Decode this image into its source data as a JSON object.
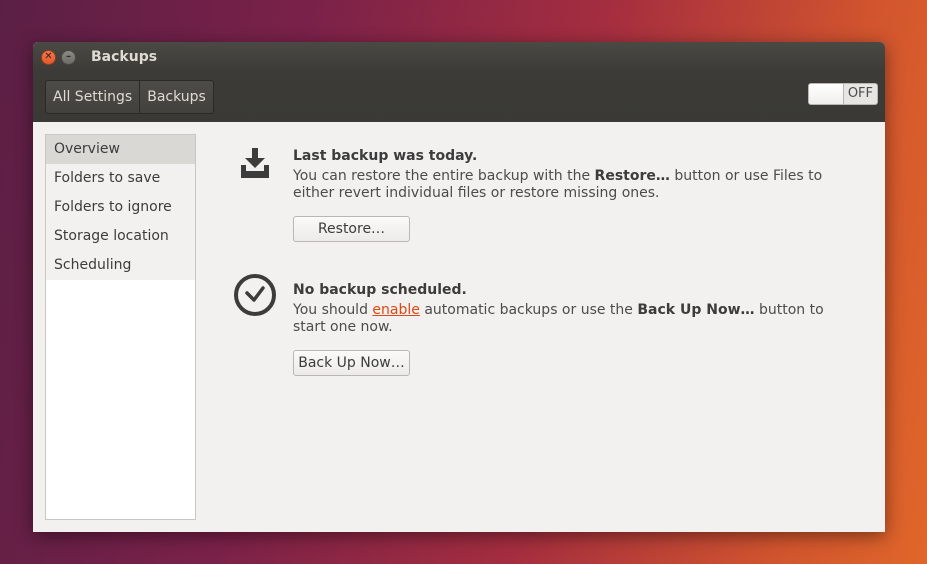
{
  "window": {
    "title": "Backups",
    "close_glyph": "✕",
    "minimize_glyph": "–"
  },
  "toolbar": {
    "nav": [
      "All Settings",
      "Backups"
    ],
    "toggle_label": "OFF"
  },
  "sidebar": {
    "items": [
      {
        "label": "Overview",
        "selected": true
      },
      {
        "label": "Folders to save",
        "selected": false
      },
      {
        "label": "Folders to ignore",
        "selected": false
      },
      {
        "label": "Storage location",
        "selected": false
      },
      {
        "label": "Scheduling",
        "selected": false
      }
    ]
  },
  "last_backup": {
    "icon": "download-tray-icon",
    "heading": "Last backup was today.",
    "desc_1": "You can restore the entire backup with the ",
    "desc_bold": "Restore…",
    "desc_2": " button or use Files to either revert individual files or restore missing ones.",
    "button_label": "Restore…"
  },
  "schedule": {
    "icon": "clock-icon",
    "heading": "No backup scheduled.",
    "desc_1": "You should ",
    "desc_link": "enable",
    "desc_2": " automatic backups or use the ",
    "desc_bold": "Back Up Now…",
    "desc_3": " button to start one now.",
    "button_label": "Back Up Now…"
  },
  "colors": {
    "accent_link": "#dd4814",
    "window_bg": "#f2f1f0",
    "titlebar_bg": "#3c3b37"
  }
}
